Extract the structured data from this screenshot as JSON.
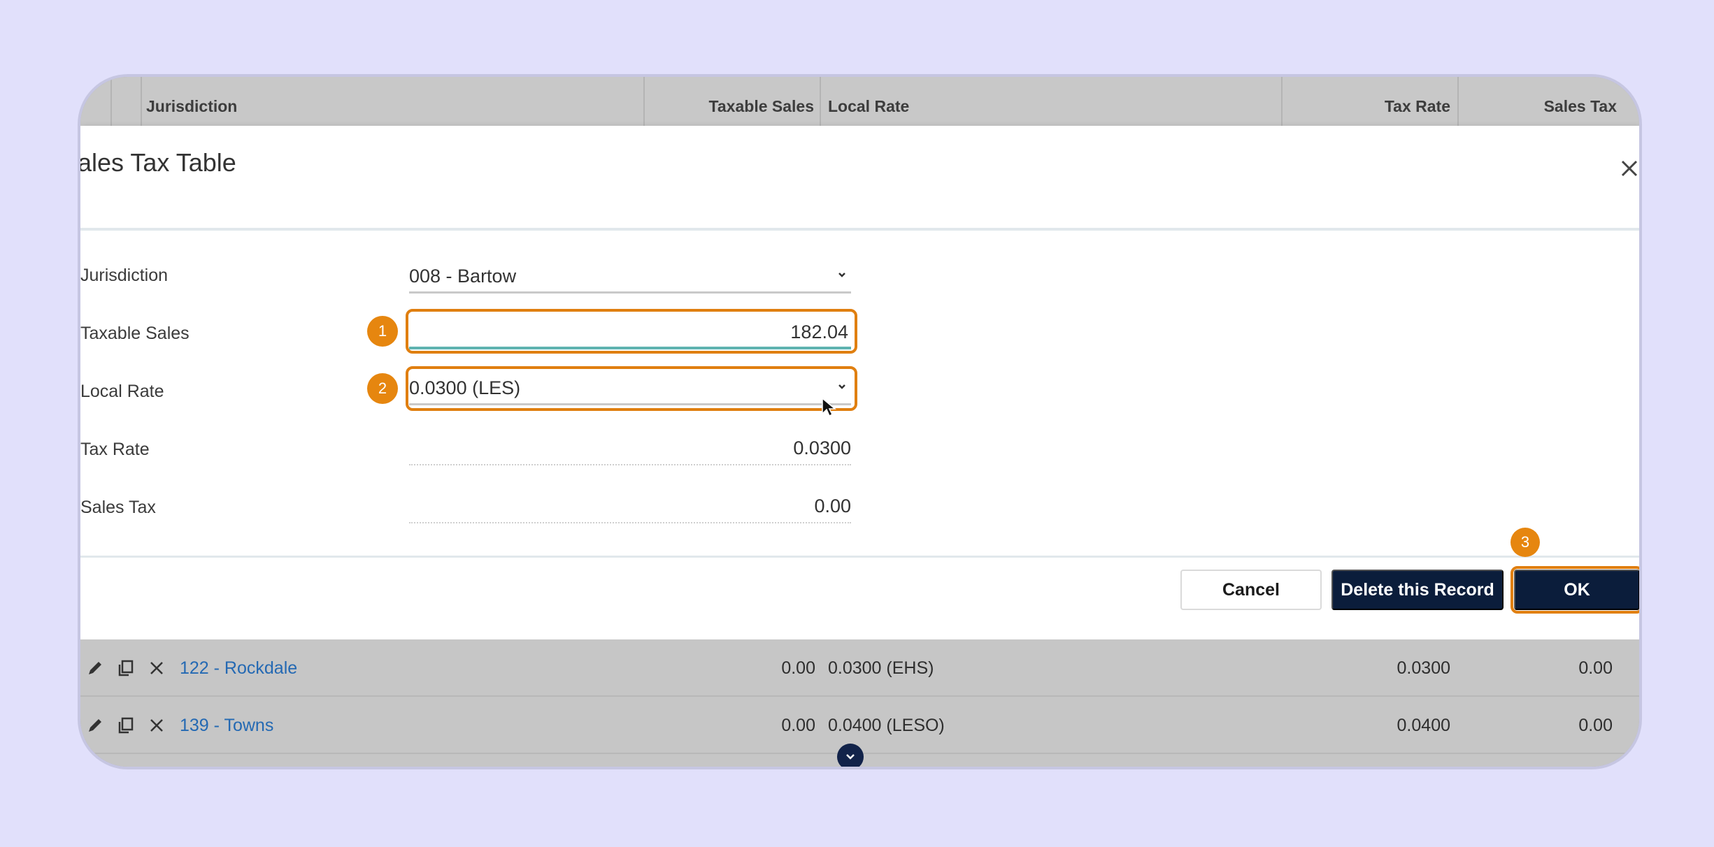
{
  "table": {
    "headers": {
      "jurisdiction": "Jurisdiction",
      "taxable_sales": "Taxable Sales",
      "local_rate": "Local Rate",
      "tax_rate": "Tax Rate",
      "sales_tax": "Sales Tax"
    },
    "rows": [
      {
        "jurisdiction": "122 - Rockdale",
        "taxable_sales": "0.00",
        "local_rate": "0.0300 (EHS)",
        "tax_rate": "0.0300",
        "sales_tax": "0.00"
      },
      {
        "jurisdiction": "139 - Towns",
        "taxable_sales": "0.00",
        "local_rate": "0.0400 (LESO)",
        "tax_rate": "0.0400",
        "sales_tax": "0.00"
      }
    ]
  },
  "modal": {
    "title": "ales Tax Table",
    "fields": {
      "jurisdiction": {
        "label": "Jurisdiction",
        "value": "008 - Bartow"
      },
      "taxable_sales": {
        "label": "Taxable Sales",
        "value": "182.04"
      },
      "local_rate": {
        "label": "Local Rate",
        "value": "0.0300 (LES)"
      },
      "tax_rate": {
        "label": "Tax Rate",
        "value": "0.0300"
      },
      "sales_tax": {
        "label": "Sales Tax",
        "value": "0.00"
      }
    },
    "buttons": {
      "cancel": "Cancel",
      "delete": "Delete this Record",
      "ok": "OK"
    }
  },
  "annotations": {
    "step1": "1",
    "step2": "2",
    "step3": "3"
  },
  "colors": {
    "page_background": "#e1e0fb",
    "highlight": "#e07f10",
    "primary_button": "#0b1d3b",
    "link": "#2469b3",
    "input_underline": "#5fb3b0"
  },
  "icons": {
    "close": "close-icon",
    "chevron": "chevron-down-icon",
    "edit": "pencil-icon",
    "copy": "copy-icon",
    "delete": "x-icon",
    "scroll": "chevron-down-circle-icon"
  }
}
